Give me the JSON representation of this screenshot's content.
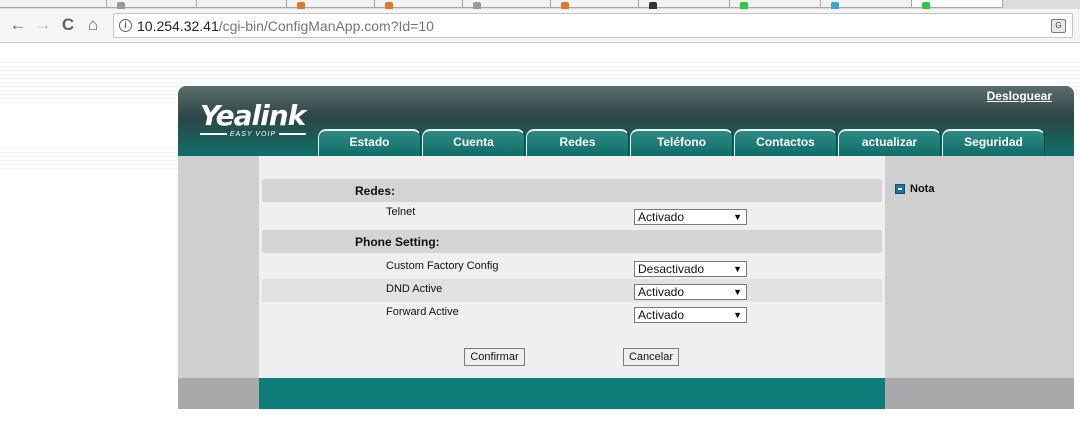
{
  "browser": {
    "url_host": "10.254.32.41",
    "url_path": "/cgi-bin/ConfigManApp.com?Id=10",
    "back_glyph": "←",
    "forward_glyph": "→",
    "reload_glyph": "C",
    "home_glyph": "⌂",
    "info_glyph": "i",
    "translate_glyph": "G"
  },
  "header": {
    "logo": "Yealink",
    "logo_sub": "EASY VOIP",
    "logout": "Desloguear",
    "tabs": [
      "Estado",
      "Cuenta",
      "Redes",
      "Teléfono",
      "Contactos",
      "actualizar",
      "Seguridad"
    ]
  },
  "sidebar": {
    "nota": "Nota"
  },
  "form": {
    "section_redes": "Redes:",
    "telnet_label": "Telnet",
    "telnet_value": "Activado",
    "section_phone": "Phone Setting:",
    "custom_factory_label": "Custom Factory Config",
    "custom_factory_value": "Desactivado",
    "dnd_label": "DND Active",
    "dnd_value": "Activado",
    "forward_label": "Forward Active",
    "forward_value": "Activado",
    "select_arrow": "▼"
  },
  "buttons": {
    "confirm": "Confirmar",
    "cancel": "Cancelar"
  },
  "colors": {
    "teal": "#0e7d7a",
    "header_dark": "#2d4645",
    "panel_gray": "#cfcfcf"
  }
}
